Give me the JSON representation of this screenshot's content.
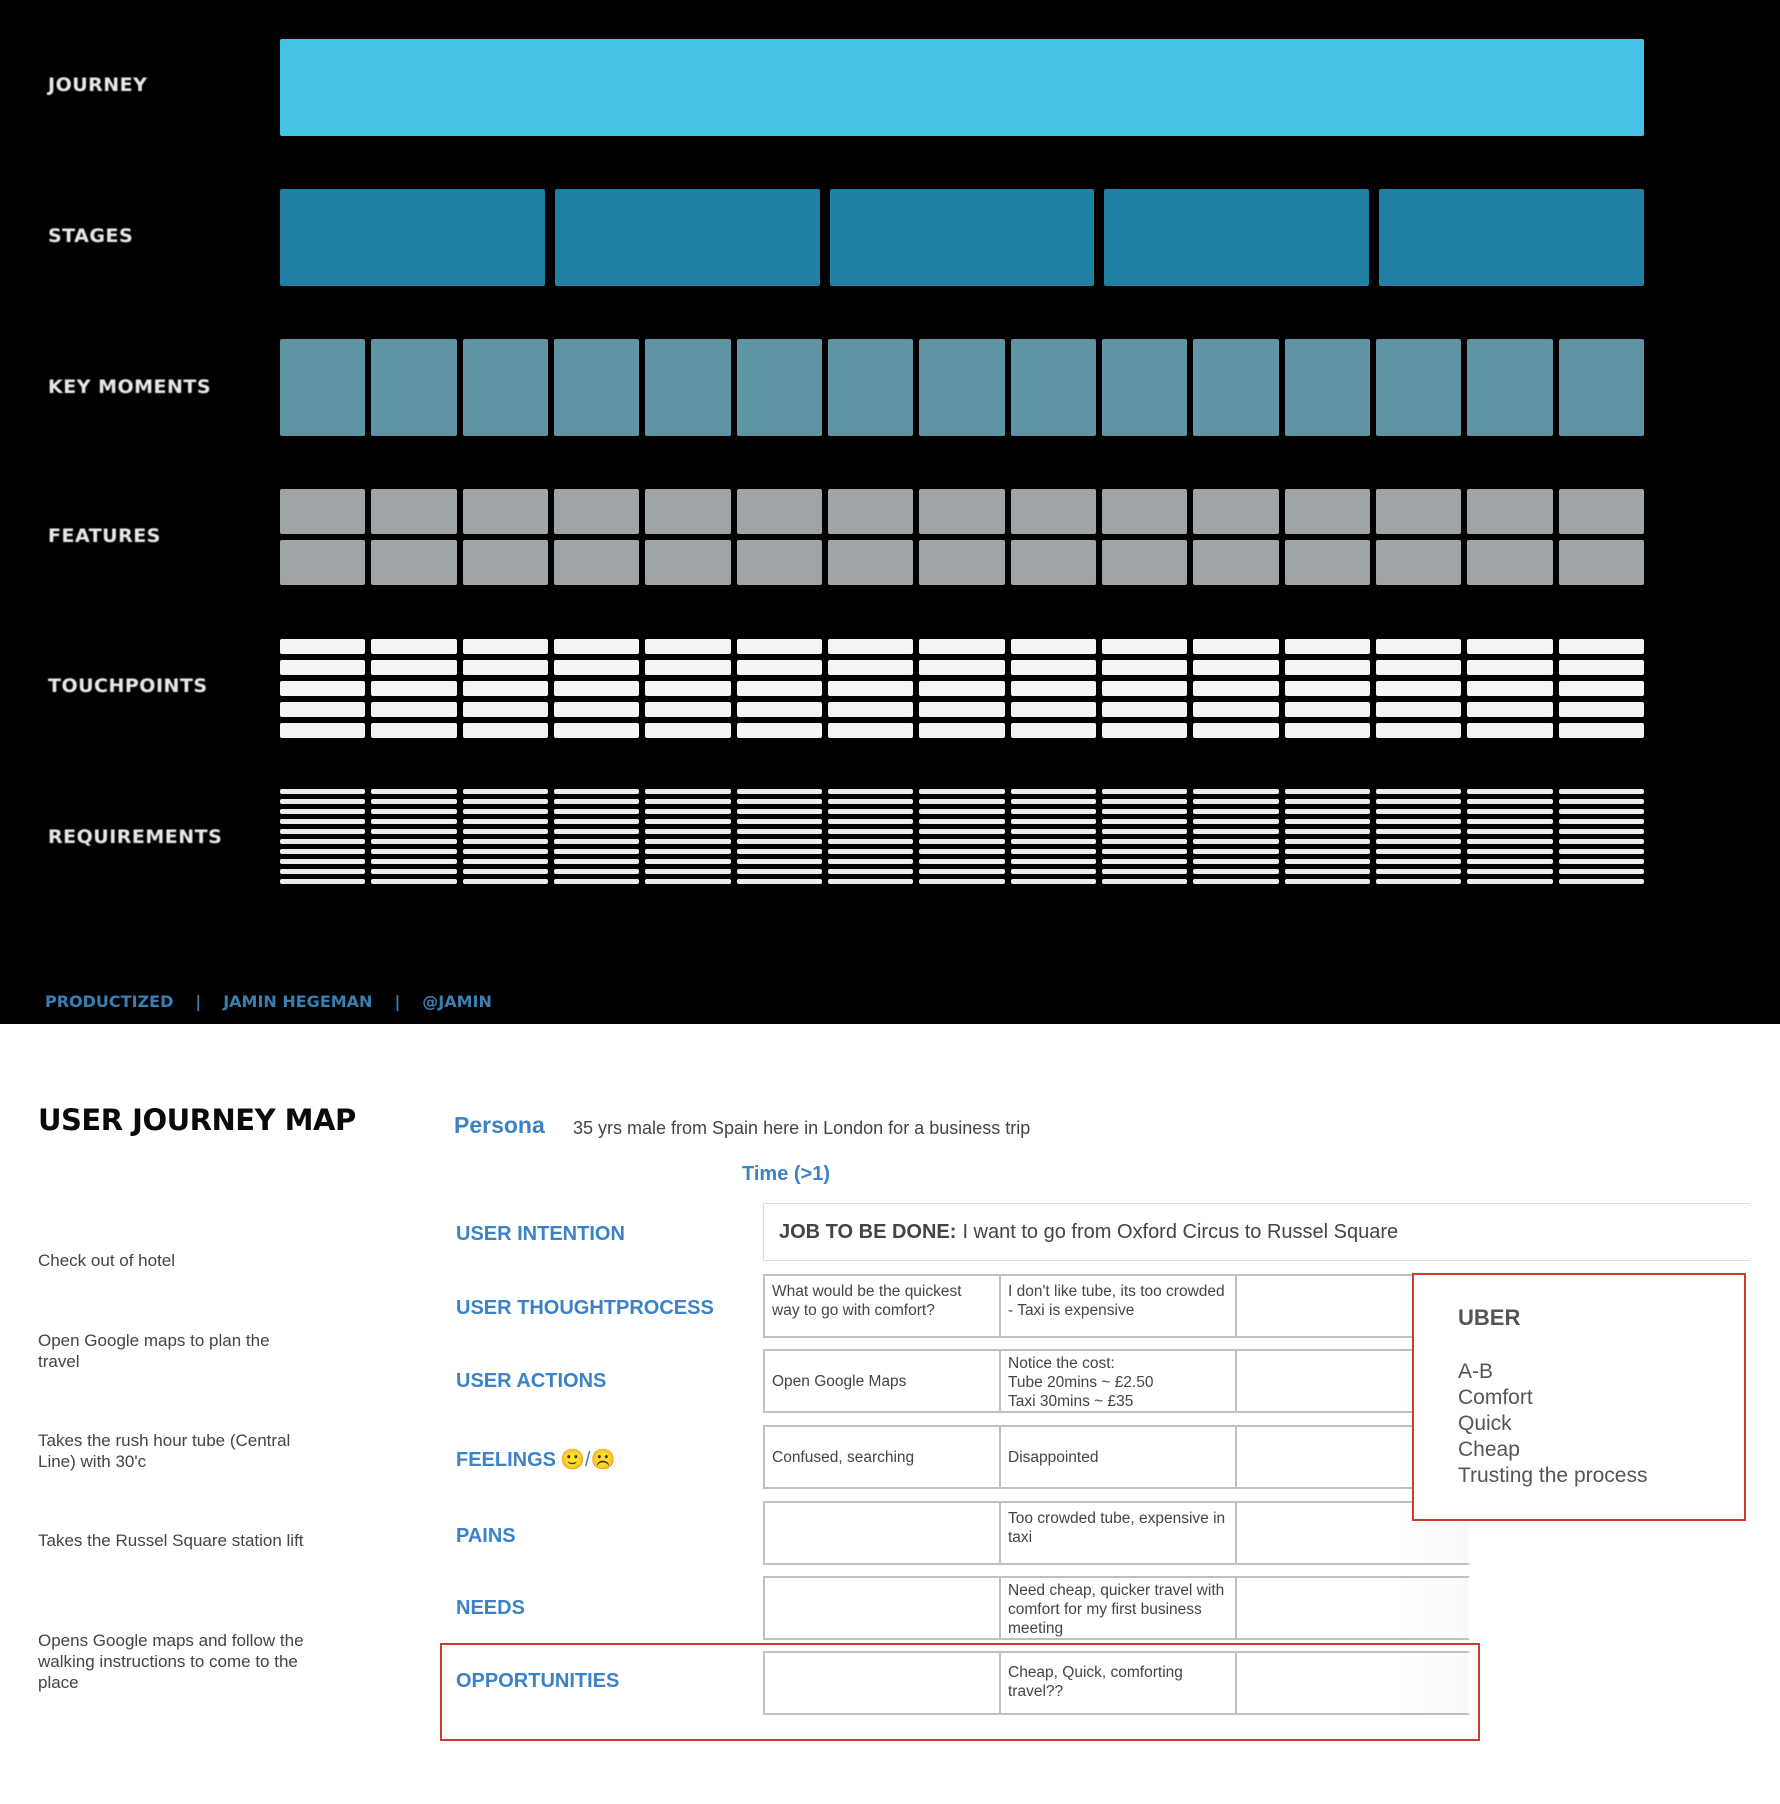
{
  "slide": {
    "rows": [
      {
        "key": "journey",
        "label": "JOURNEY"
      },
      {
        "key": "stages",
        "label": "STAGES"
      },
      {
        "key": "key_moments",
        "label": "KEY MOMENTS"
      },
      {
        "key": "features",
        "label": "FEATURES"
      },
      {
        "key": "touchpoints",
        "label": "TOUCHPOINTS"
      },
      {
        "key": "requirements",
        "label": "REQUIREMENTS"
      }
    ],
    "stage_count": 5,
    "moment_count": 15,
    "feature_rows": 2,
    "touchpoint_rows": 5,
    "requirement_rows": 10,
    "footer": [
      "PRODUCTIZED",
      "|",
      "JAMIN HEGEMAN",
      "|",
      "@JAMIN"
    ],
    "colors": {
      "background": "#000000",
      "journey": "#44c3e6",
      "stages": "#1f80a4",
      "key_moments": "#5f95a3",
      "features": "#9fa4a7",
      "touchpoints": "#f4f4f4",
      "footer": "#3a7fb0"
    }
  },
  "map": {
    "title": "USER JOURNEY MAP",
    "persona_label": "Persona",
    "persona_text": "35 yrs male from Spain here in London for a business trip",
    "time_label": "Time (>1)",
    "steps": [
      "Check out of hotel",
      "Open Google maps to plan the travel",
      "Takes the rush hour tube (Central Line) with 30'c",
      "Takes the Russel Square station lift",
      "Opens Google maps and follow the walking instructions to come to the place"
    ],
    "row_labels": {
      "intention": "USER INTENTION",
      "thought": "USER THOUGHTPROCESS",
      "actions": "USER ACTIONS",
      "feelings": "FEELINGS",
      "feelings_emoji": "🙂/☹️",
      "pains": "PAINS",
      "needs": "NEEDS",
      "opportunities": "OPPORTUNITIES"
    },
    "jtbd_label": "JOB TO BE DONE:",
    "jtbd_text": "I want to go from Oxford Circus to Russel Square",
    "cells": {
      "thought": [
        "What would be the quickest way to go with comfort?",
        "I don't like tube, its too crowded - Taxi is expensive",
        ""
      ],
      "actions": [
        "Open Google Maps",
        "Notice the cost:\nTube 20mins ~ £2.50\nTaxi 30mins ~ £35",
        ""
      ],
      "feelings": [
        "Confused, searching",
        "Disappointed",
        ""
      ],
      "pains": [
        "",
        "Too crowded tube, expensive in taxi",
        ""
      ],
      "needs": [
        "",
        "Need cheap, quicker travel with comfort for my first business meeting",
        ""
      ],
      "opportunities": [
        "",
        "Cheap, Quick, comforting travel??",
        ""
      ]
    },
    "uber": {
      "title": "UBER",
      "items": [
        "A-B",
        "Comfort",
        "Quick",
        "Cheap",
        "Trusting the process"
      ]
    },
    "colors": {
      "accent_blue": "#3b82c8",
      "highlight_red": "#d03a2f"
    }
  }
}
